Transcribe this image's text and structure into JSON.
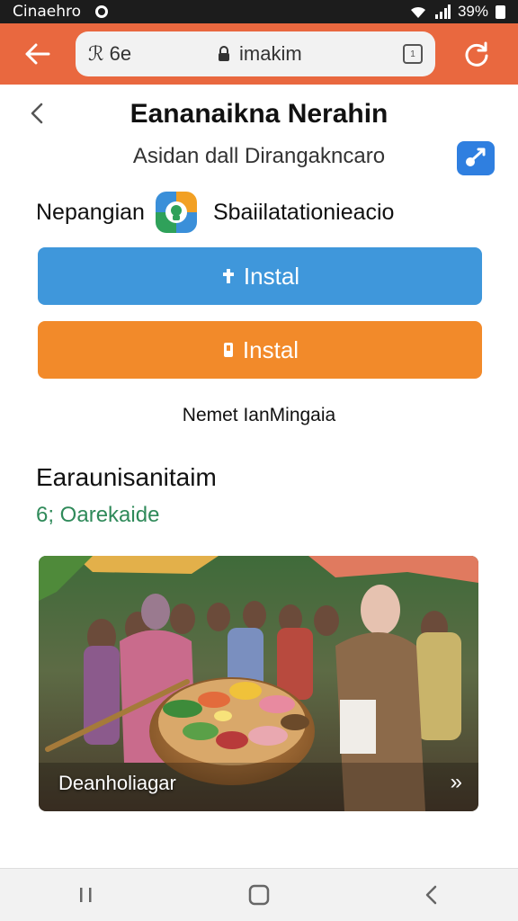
{
  "status_bar": {
    "carrier": "Cinaehro",
    "battery_text": "39%",
    "icons": [
      "wifi-icon",
      "signal-icon",
      "battery-icon"
    ]
  },
  "browser": {
    "url_prefix": "ℛ 6e",
    "url_text": "imakim",
    "tab_count": "1",
    "toolbar_color": "#e9683f"
  },
  "page": {
    "title": "Eananaikna Nerahin",
    "subtitle": "Asidan dall Dirangakncaro",
    "developer": "Nepangian",
    "category": "Sbaiilatationieacio",
    "install_primary": "Instal",
    "install_secondary": "Instal",
    "note": "Nemet IanMingaia",
    "section_title": "Earaunisanitaim",
    "section_subtitle": "6; Oarekaide",
    "photo_caption": "Deanholiagar",
    "colors": {
      "primary_button": "#3f97db",
      "secondary_button": "#f28a2a",
      "accent_green": "#2f8a5a"
    }
  },
  "nav": {
    "icons": [
      "recents-icon",
      "home-icon",
      "back-icon"
    ]
  }
}
